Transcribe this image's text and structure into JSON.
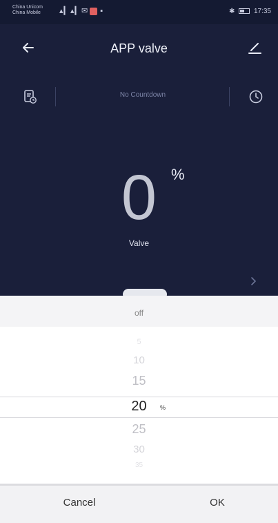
{
  "status_bar": {
    "carrier_line1": "China Unicom",
    "carrier_line2": "China Mobile",
    "time": "17:35"
  },
  "header": {
    "title": "APP  valve",
    "back_icon": "arrow-left-icon",
    "edit_icon": "pencil-icon"
  },
  "countdown": {
    "label": "No Countdown",
    "left_icon": "timer-list-icon",
    "right_icon": "clock-icon"
  },
  "main": {
    "value": "0",
    "unit": "%",
    "label": "Valve"
  },
  "picker": {
    "top_option": "off",
    "options": [
      "5",
      "10",
      "15",
      "20",
      "25",
      "30",
      "35"
    ],
    "selected": "20",
    "selected_unit": "%"
  },
  "dialog": {
    "cancel_label": "Cancel",
    "ok_label": "OK"
  },
  "colors": {
    "background": "#1a1f3a",
    "accent": "#ffffff"
  }
}
